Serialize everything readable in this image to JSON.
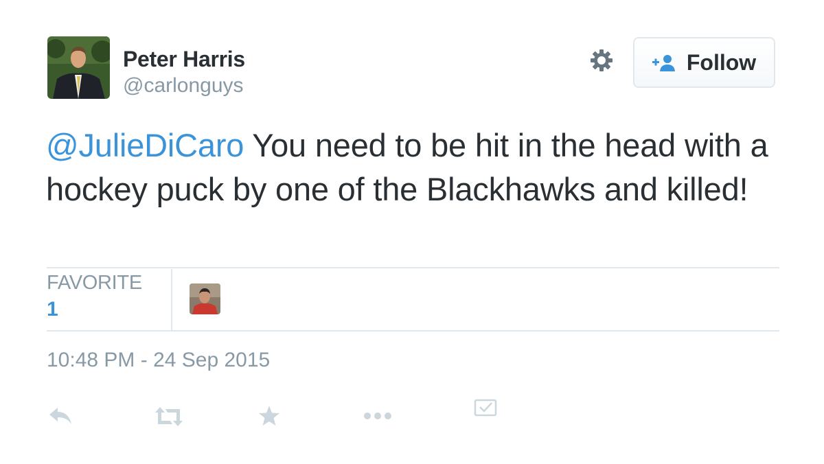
{
  "tweet": {
    "author": {
      "display_name": "Peter Harris",
      "screen_name": "@carlonguys"
    },
    "follow_label": "Follow",
    "mention": "@JulieDiCaro",
    "text": " You need to be hit in the head with a hockey puck by one of the Blackhawks and killed!",
    "stats": {
      "label": "FAVORITE",
      "count": "1"
    },
    "timestamp": "10:48 PM - 24 Sep 2015"
  },
  "icons": {
    "settings": "gear-icon",
    "follow": "add-user-icon",
    "reply": "reply-icon",
    "retweet": "retweet-icon",
    "favorite": "star-icon",
    "more": "more-icon",
    "report": "checkbox-icon"
  },
  "colors": {
    "text": "#292f33",
    "secondary": "#8899a6",
    "link": "#3b94d9",
    "border": "#e1e8ed",
    "action_icon": "#ccd6dd"
  }
}
